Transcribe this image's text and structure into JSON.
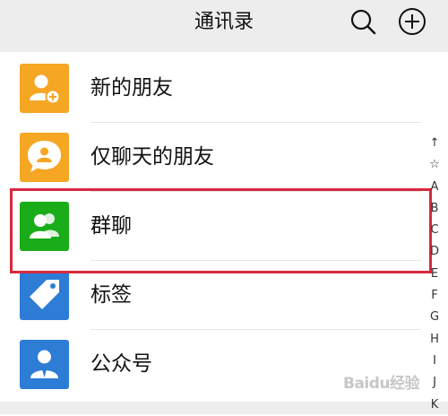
{
  "header": {
    "title": "通讯录",
    "search_icon": "search-icon",
    "add_icon": "plus-circle-icon"
  },
  "list": {
    "items": [
      {
        "label": "新的朋友",
        "icon": "add-friend-icon",
        "color": "#f5a623"
      },
      {
        "label": "仅聊天的朋友",
        "icon": "chat-friend-icon",
        "color": "#f5a623"
      },
      {
        "label": "群聊",
        "icon": "group-chat-icon",
        "color": "#1aad19"
      },
      {
        "label": "标签",
        "icon": "tag-icon",
        "color": "#2d7cd6"
      },
      {
        "label": "公众号",
        "icon": "official-account-icon",
        "color": "#2d7cd6"
      }
    ]
  },
  "index_bar": {
    "letters": [
      "↑",
      "☆",
      "A",
      "B",
      "C",
      "D",
      "E",
      "F",
      "G",
      "H",
      "I",
      "J",
      "K"
    ]
  },
  "highlight_color": "#d7283d",
  "watermark": {
    "text": "Baidu经验"
  }
}
